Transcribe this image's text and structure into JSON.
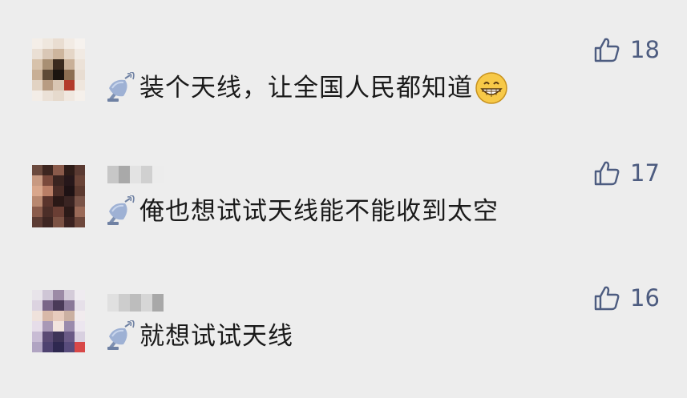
{
  "comments": [
    {
      "text": "装个天线，让全国人民都知道",
      "likes": "18",
      "has_emoji": true,
      "emoji_icon": "grinning-face-icon"
    },
    {
      "text": "俺也想试试天线能不能收到太空",
      "likes": "17",
      "has_emoji": false
    },
    {
      "text": "就想试试天线",
      "likes": "16",
      "has_emoji": false
    }
  ],
  "icons": {
    "prefix": "satellite-antenna-icon",
    "like": "thumbs-up-icon"
  },
  "colors": {
    "background": "#ededed",
    "like_count": "#4d5c80",
    "text": "#1a1a1a"
  }
}
